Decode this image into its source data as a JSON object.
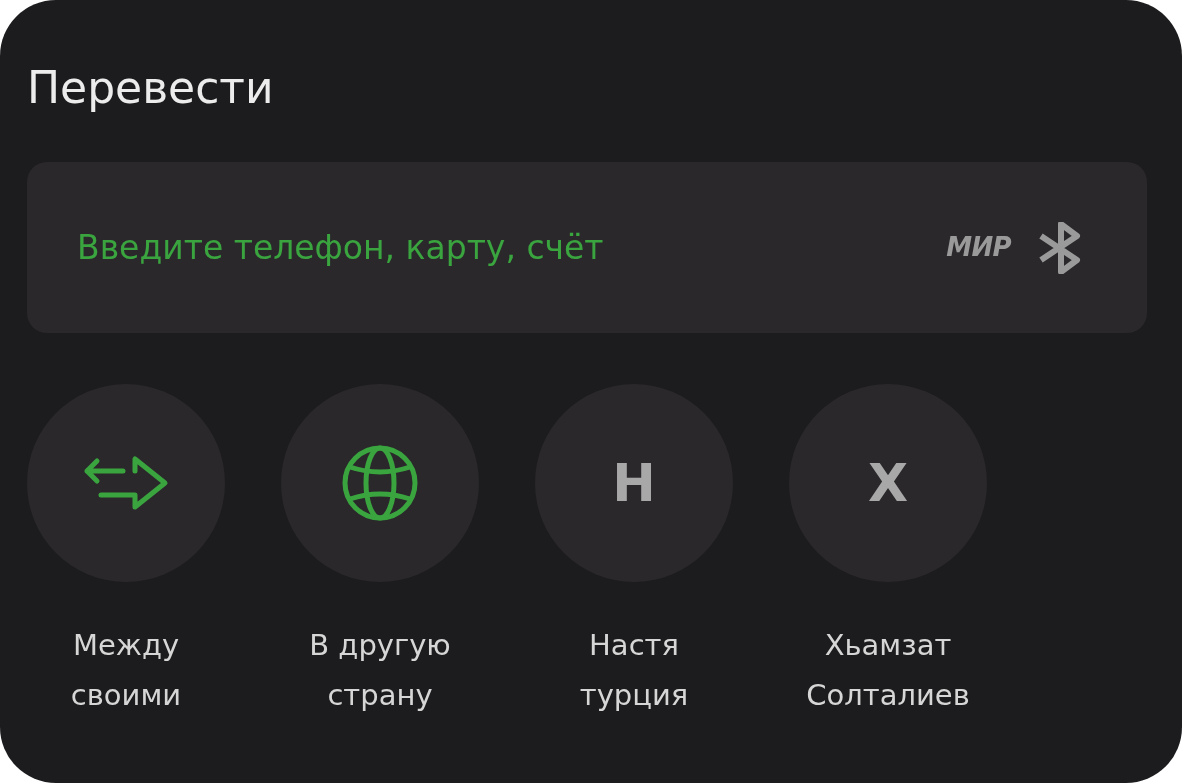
{
  "title": "Перевести",
  "search": {
    "placeholder": "Введите телефон, карту, счёт",
    "mir_logo": "МИР"
  },
  "shortcuts": [
    {
      "kind": "transfer",
      "label_lines": [
        "Между",
        "своими"
      ]
    },
    {
      "kind": "globe",
      "label_lines": [
        "В другую",
        "страну"
      ]
    },
    {
      "kind": "contact",
      "initial": "Н",
      "label_lines": [
        "Настя",
        "турция"
      ]
    },
    {
      "kind": "contact",
      "initial": "Х",
      "label_lines": [
        "Хьамзат",
        "Солталиев"
      ]
    }
  ]
}
